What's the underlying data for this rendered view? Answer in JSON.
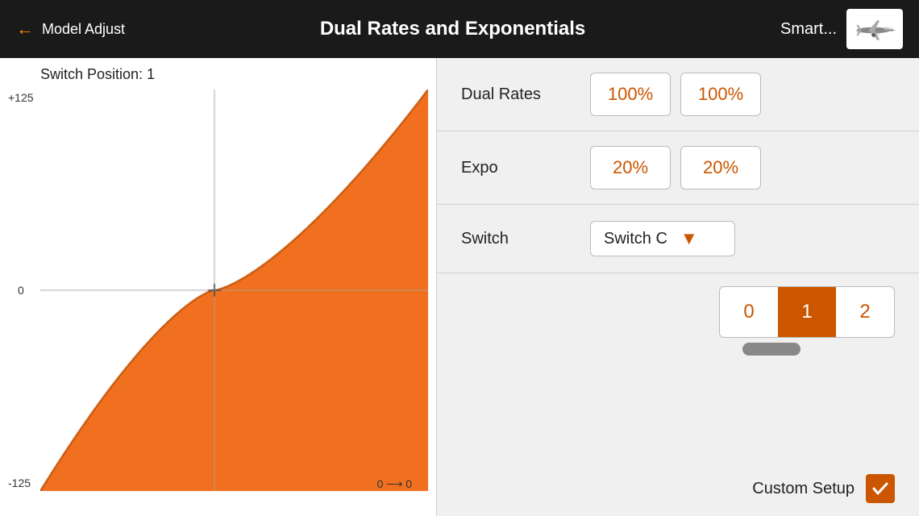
{
  "header": {
    "back_arrow": "←",
    "back_label": "Model Adjust",
    "title": "Dual Rates and Exponentials",
    "model_name": "Smart...",
    "model_icon_alt": "plane"
  },
  "graph": {
    "switch_position_label": "Switch Position: 1",
    "y_top": "+125",
    "y_zero": "0",
    "y_bottom": "-125",
    "x_label": "0 ⟶ 0"
  },
  "right_panel": {
    "dual_rates": {
      "label": "Dual Rates",
      "value1": "100%",
      "value2": "100%"
    },
    "expo": {
      "label": "Expo",
      "value1": "20%",
      "value2": "20%"
    },
    "switch": {
      "label": "Switch",
      "selected": "Switch C"
    },
    "positions": [
      "0",
      "1",
      "2"
    ],
    "active_position": 1,
    "custom_setup_label": "Custom Setup",
    "custom_setup_checked": true
  }
}
